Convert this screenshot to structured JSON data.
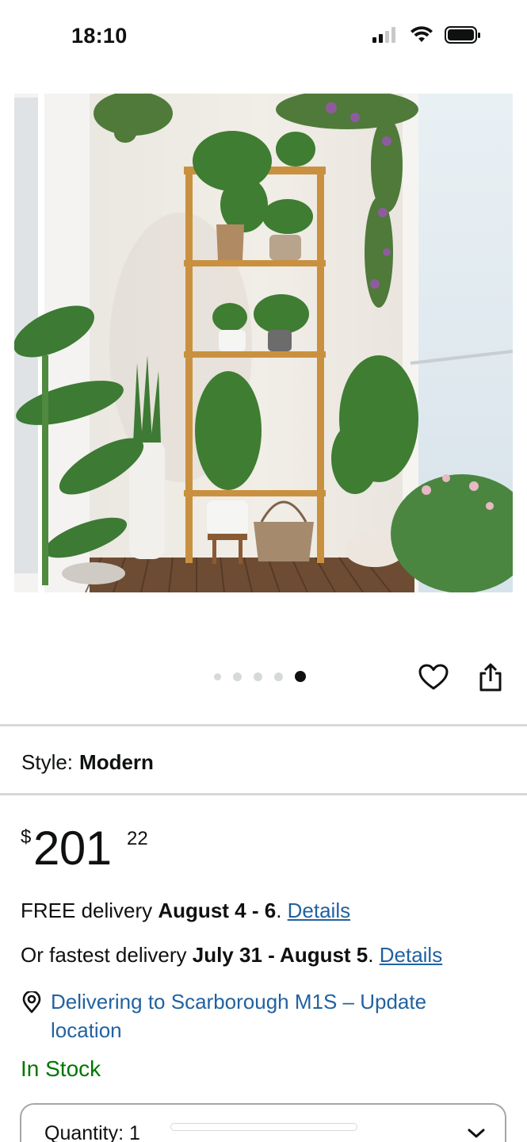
{
  "status_bar": {
    "time": "18:10",
    "icons": [
      "cellular-signal-icon",
      "wifi-icon",
      "battery-icon"
    ]
  },
  "gallery": {
    "image_count": 5,
    "active_index": 4,
    "image_description_icon": "product-photo",
    "actions": [
      "heart-icon",
      "share-icon"
    ]
  },
  "style": {
    "label": "Style:",
    "value": "Modern"
  },
  "price": {
    "currency": "$",
    "whole": "201",
    "fraction": "22"
  },
  "delivery": {
    "free_prefix": "FREE delivery ",
    "free_dates": "August 4 - 6",
    "free_suffix": ". ",
    "free_link": "Details",
    "fast_prefix": "Or fastest delivery ",
    "fast_dates": "July 31 - August 5",
    "fast_suffix": ". ",
    "fast_link": "Details"
  },
  "location": {
    "text": "Delivering to Scarborough M1S – Update location"
  },
  "stock": {
    "text": "In Stock"
  },
  "quantity": {
    "label": "Quantity:",
    "value": "1"
  },
  "colors": {
    "link": "#2162a1",
    "in_stock": "#007600",
    "text": "#0f1111",
    "divider": "#d5d9d9"
  }
}
